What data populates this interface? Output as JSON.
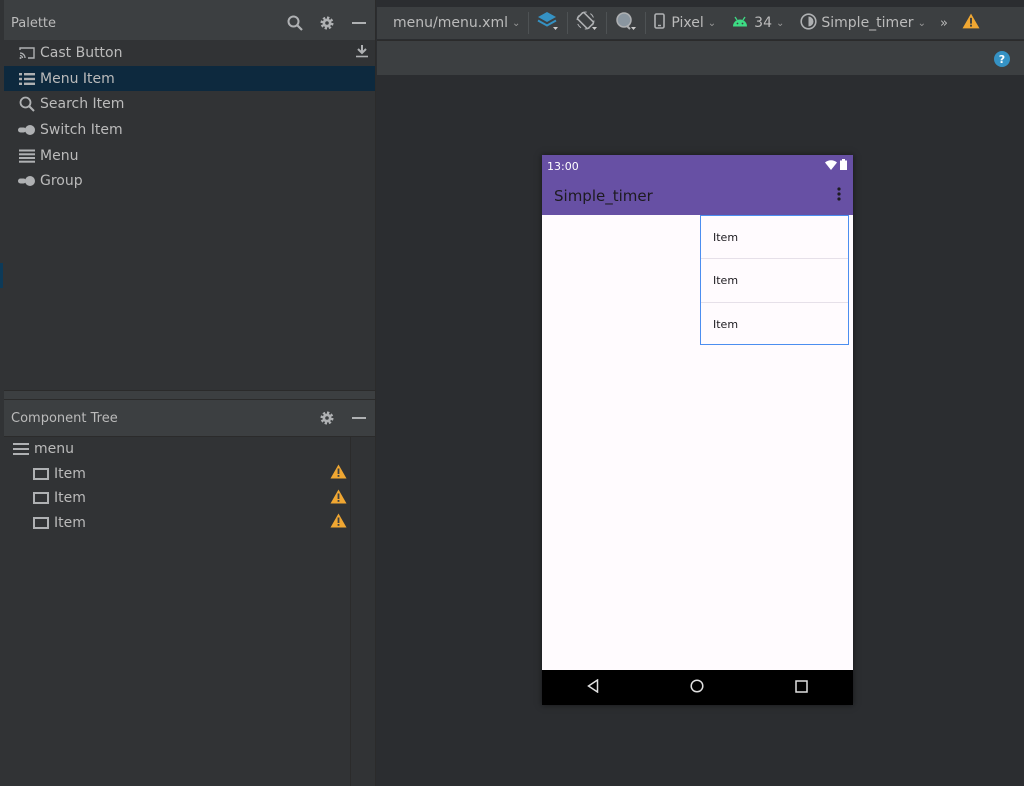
{
  "palette": {
    "title": "Palette",
    "header_icons": [
      "search-icon",
      "gear-icon",
      "minimize-icon"
    ],
    "items": [
      {
        "label": "Cast Button",
        "icon": "cast-icon",
        "download": true
      },
      {
        "label": "Menu Item",
        "icon": "menu-item-icon",
        "selected": true
      },
      {
        "label": "Search Item",
        "icon": "search-icon"
      },
      {
        "label": "Switch Item",
        "icon": "switch-icon"
      },
      {
        "label": "Menu",
        "icon": "menu-icon"
      },
      {
        "label": "Group",
        "icon": "group-icon"
      }
    ]
  },
  "component_tree": {
    "title": "Component Tree",
    "root": {
      "label": "menu",
      "icon": "menu-icon"
    },
    "children": [
      {
        "label": "Item",
        "warning": true
      },
      {
        "label": "Item",
        "warning": true
      },
      {
        "label": "Item",
        "warning": true
      }
    ]
  },
  "toolbar": {
    "file": "menu/menu.xml",
    "device": "Pixel",
    "api": "34",
    "theme": "Simple_timer",
    "overflow": "»"
  },
  "help_label": "?",
  "phone": {
    "time": "13:00",
    "app_title": "Simple_timer",
    "menu_items": [
      "Item",
      "Item",
      "Item"
    ],
    "colors": {
      "primary": "#6750a4",
      "selection": "#4c8ef0"
    }
  }
}
